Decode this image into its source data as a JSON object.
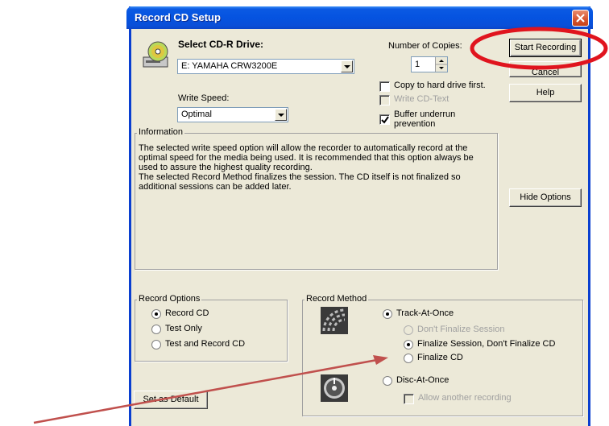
{
  "window": {
    "title": "Record CD Setup"
  },
  "drive": {
    "label": "Select CD-R Drive:",
    "selected": "E: YAMAHA CRW3200E"
  },
  "copies": {
    "label": "Number of Copies:",
    "value": "1"
  },
  "write_speed": {
    "label": "Write Speed:",
    "selected": "Optimal"
  },
  "options": {
    "copy_to_hd": {
      "label": "Copy to hard drive first.",
      "checked": false
    },
    "write_cd_text": {
      "label": "Write CD-Text",
      "checked": false,
      "enabled": false
    },
    "buffer_underrun_line1": "Buffer underrun",
    "buffer_underrun_line2": "prevention"
  },
  "buttons": {
    "start_recording": "Start Recording",
    "cancel": "Cancel",
    "help": "Help",
    "hide_options": "Hide Options",
    "set_as_default": "Set as Default"
  },
  "information": {
    "title": "Information",
    "line1": "The selected write speed option will allow the recorder to automatically record at the",
    "line2": "optimal speed for the media being used. It is recommended that this option always be",
    "line3": "used to assure the highest quality recording.",
    "line4": "The selected Record Method finalizes the session. The CD itself is not finalized so",
    "line5": "additional sessions can be added later."
  },
  "record_options": {
    "title": "Record Options",
    "items": [
      {
        "label": "Record CD",
        "selected": true
      },
      {
        "label": "Test Only",
        "selected": false
      },
      {
        "label": "Test and Record CD",
        "selected": false
      }
    ]
  },
  "record_method": {
    "title": "Record Method",
    "track_at_once": "Track-At-Once",
    "dont_finalize": "Don't Finalize Session",
    "finalize_session": "Finalize Session, Don't Finalize CD",
    "finalize_cd": "Finalize CD",
    "disc_at_once": "Disc-At-Once",
    "allow_another": "Allow another recording"
  },
  "annotation": {
    "highlight_color": "#e0141e",
    "arrow_color": "#c0504d"
  }
}
